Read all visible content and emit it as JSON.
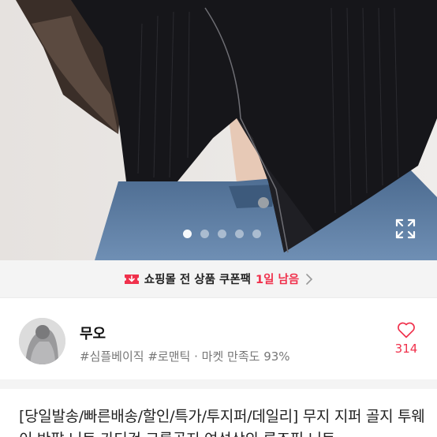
{
  "gallery": {
    "image_desc_icon": "product-photo",
    "page_index": 1,
    "page_count": 6,
    "fullscreen_icon": "expand-icon"
  },
  "coupon_banner": {
    "icon": "coupon-icon",
    "text": "쇼핑몰 전 상품 쿠폰팩",
    "remain": "1일 남음",
    "chevron_icon": "chevron-right-icon",
    "accent": "#f0314c"
  },
  "shop": {
    "name": "무오",
    "tags": "#심플베이직 #로맨틱",
    "separator": "·",
    "satisfaction": "마켓 만족도 93%",
    "like_icon": "heart-icon",
    "like_count": "314"
  },
  "product": {
    "title": "[당일발송/빠른배송/할인/특가/투지퍼/데일리] 무지 지퍼 골지 투웨이 반팔 니트 가디건 크롭골지 여성상의 루즈핏 니트"
  }
}
